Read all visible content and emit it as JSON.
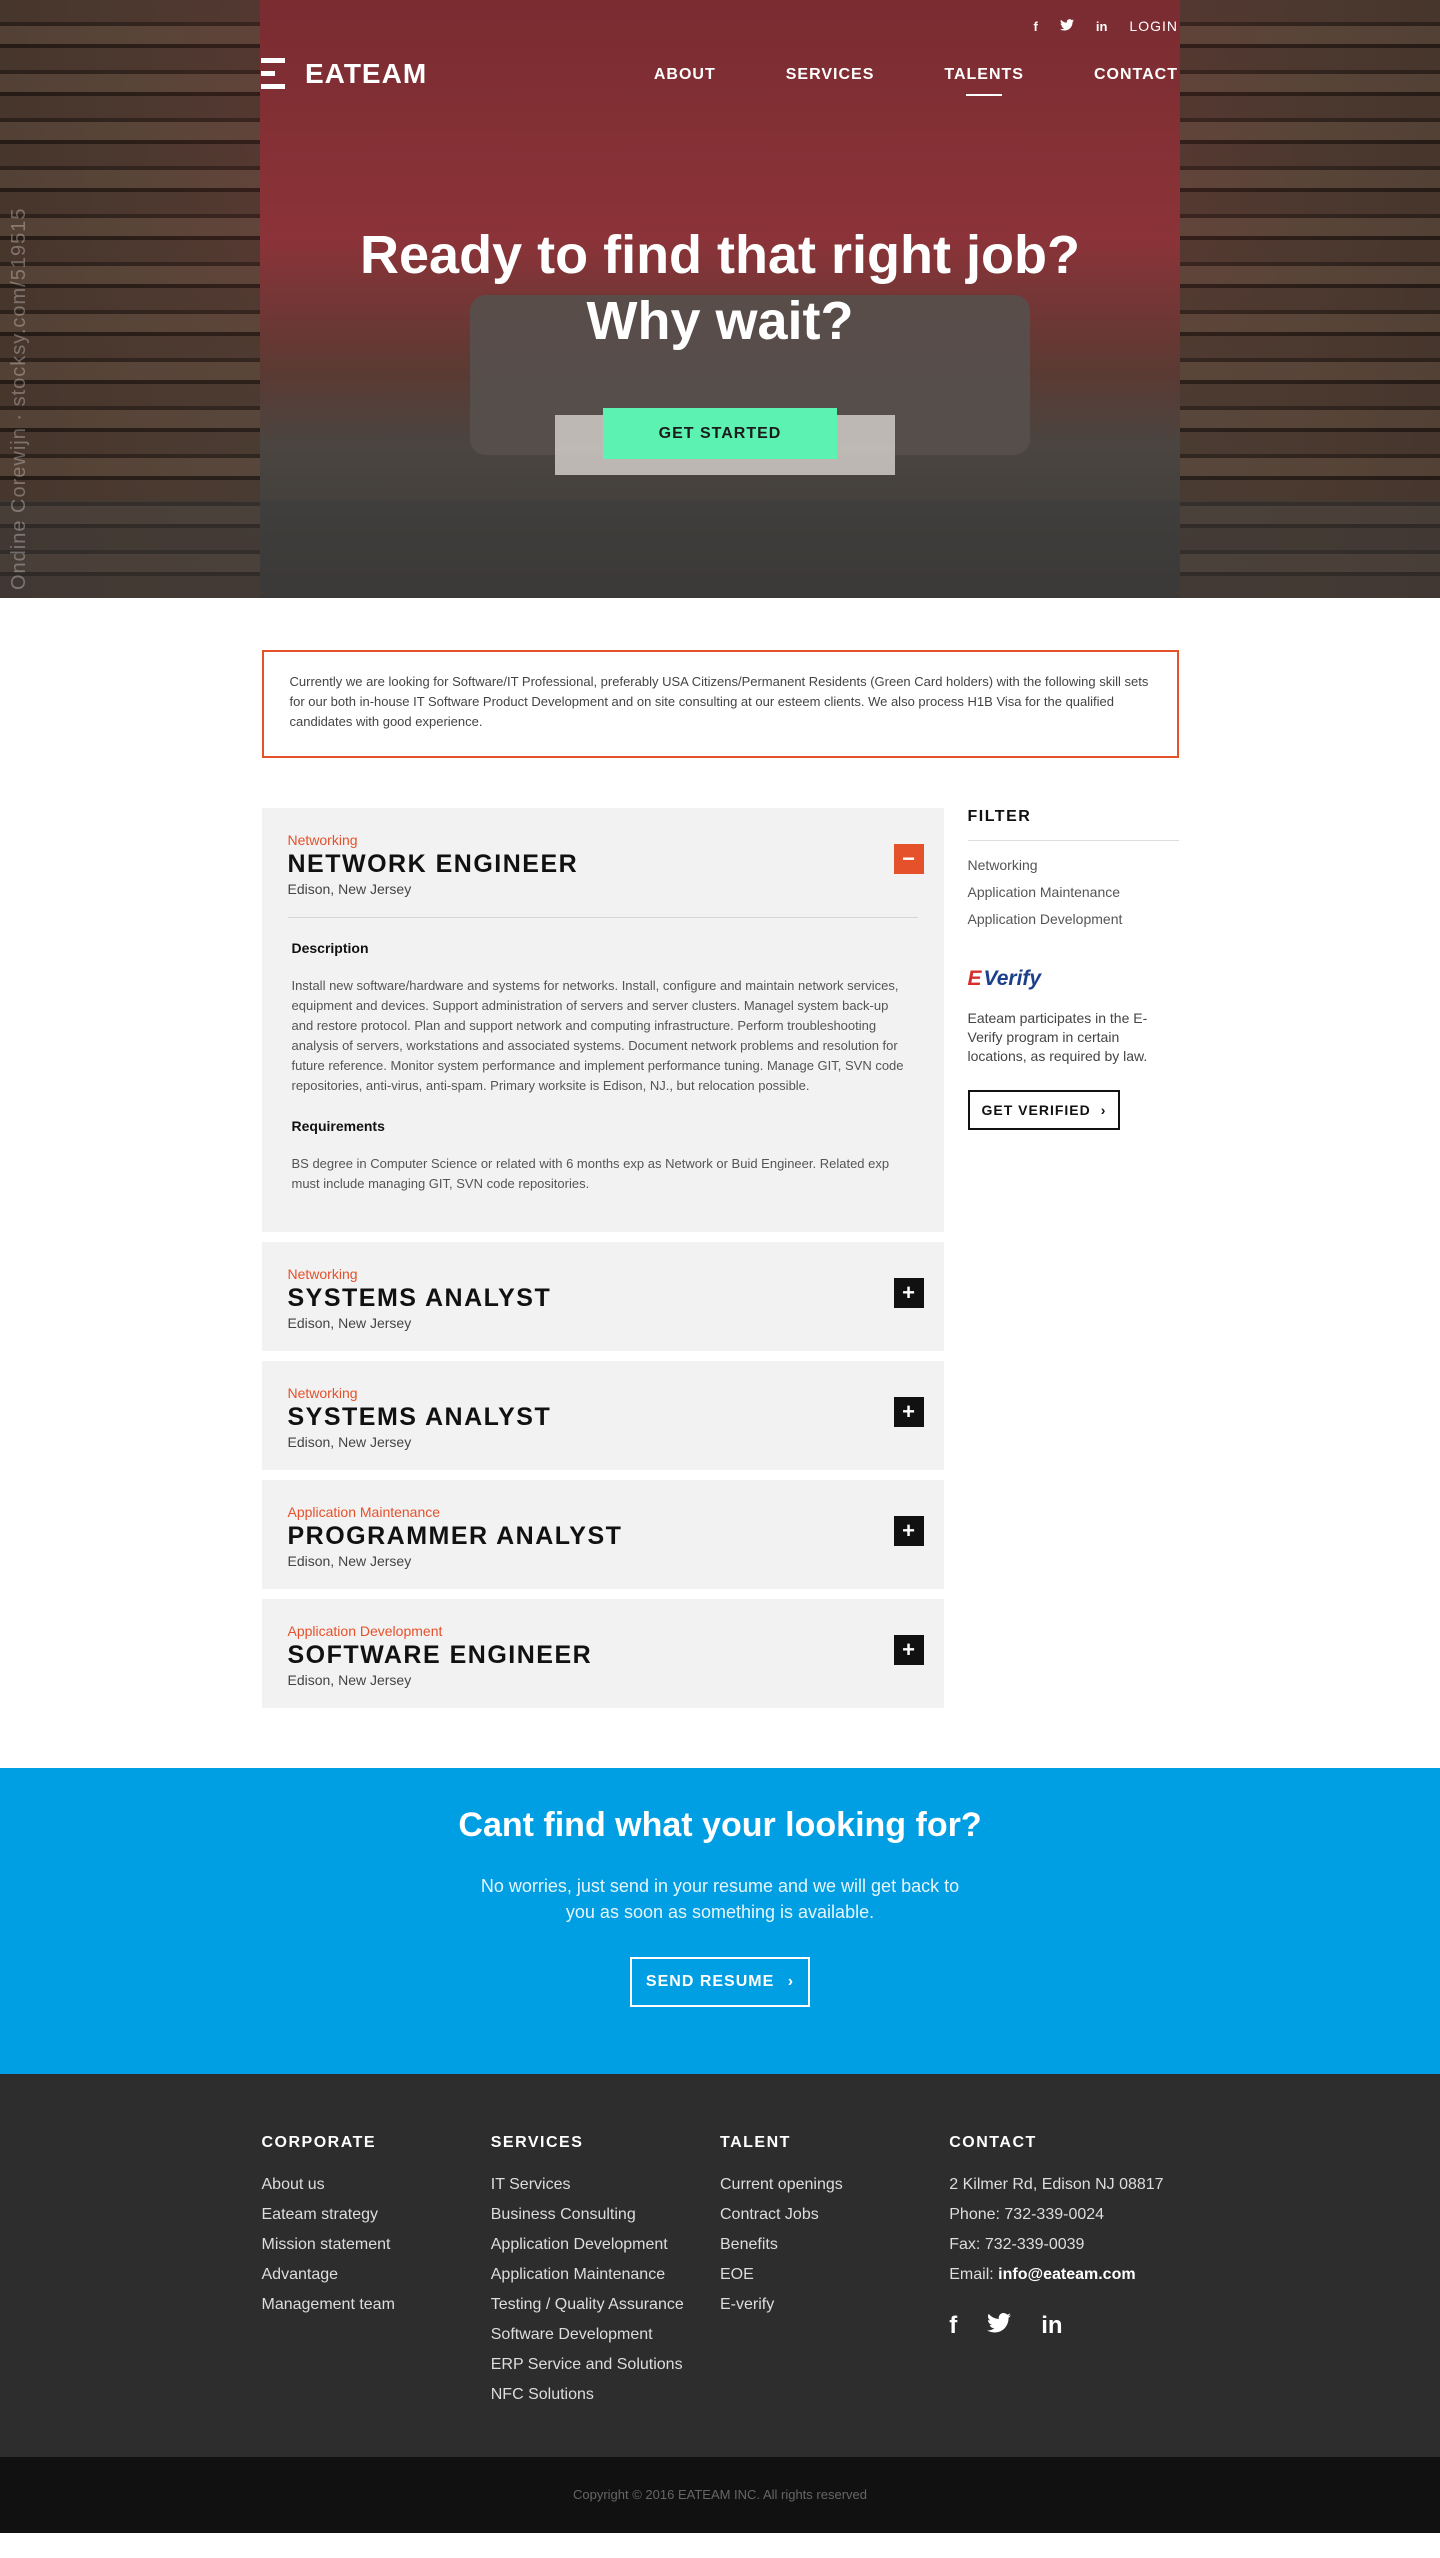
{
  "header": {
    "social": [
      "f",
      "t",
      "in"
    ],
    "login": "LOGIN",
    "logo_mark": "E",
    "logo_word": "EATEAM",
    "nav": [
      "ABOUT",
      "SERVICES",
      "TALENTS",
      "CONTACT"
    ],
    "active_nav": "TALENTS"
  },
  "hero": {
    "headline_line1": "Ready to find that right job?",
    "headline_line2": "Why wait?",
    "cta": "GET STARTED",
    "watermark": "Ondine Corewijn · stocksy.com/519515"
  },
  "notice": "Currently we are looking for Software/IT Professional, preferably USA Citizens/Permanent Residents (Green Card holders) with the following skill sets for our both in-house IT Software Product Development and on site consulting at our esteem clients. We also process H1B Visa for the qualified candidates with good experience.",
  "jobs": [
    {
      "category": "Networking",
      "title": "NETWORK ENGINEER",
      "location": "Edison, New Jersey",
      "toggle": "−",
      "description_label": "Description",
      "description": "Install new software/hardware and systems for networks. Install, configure and maintain network services, equipment and devices. Support administration of servers and server clusters. Managel system back-up and restore protocol. Plan and support network and computing infrastructure. Perform troubleshooting analysis of servers, workstations and associated systems. Document network problems and resolution for future reference. Monitor system performance and implement performance tuning. Manage GIT, SVN code repositories, anti-virus, anti-spam. Primary worksite is Edison, NJ., but relocation possible.",
      "requirements_label": "Requirements",
      "requirements": "BS degree in Computer Science or related with 6 months exp as Network or Buid Engineer. Related exp must include managing GIT, SVN code repositories."
    },
    {
      "category": "Networking",
      "title": "SYSTEMS ANALYST",
      "location": "Edison, New Jersey",
      "toggle": "+"
    },
    {
      "category": "Networking",
      "title": "SYSTEMS ANALYST",
      "location": "Edison, New Jersey",
      "toggle": "+"
    },
    {
      "category": "Application Maintenance",
      "title": "PROGRAMMER ANALYST",
      "location": "Edison, New Jersey",
      "toggle": "+"
    },
    {
      "category": "Application Development",
      "title": "SOFTWARE ENGINEER",
      "location": "Edison, New Jersey",
      "toggle": "+"
    }
  ],
  "sidebar": {
    "filter_title": "FILTER",
    "filters": [
      "Networking",
      "Application Maintenance",
      "Application Development"
    ],
    "everify_e": "E",
    "everify_word": "Verify",
    "everify_text": "Eateam participates in the E-Verify program in certain locations, as required by law.",
    "get_verified": "GET VERIFIED",
    "chevron": "›"
  },
  "band": {
    "title": "Cant find what your looking for?",
    "text": "No worries, just send in your resume and we will get back to you as soon as something is available.",
    "button": "SEND RESUME",
    "chevron": "›"
  },
  "footer": {
    "corporate": {
      "title": "CORPORATE",
      "items": [
        "About us",
        "Eateam strategy",
        "Mission statement",
        "Advantage",
        "Management team"
      ]
    },
    "services": {
      "title": "SERVICES",
      "items": [
        "IT Services",
        "Business Consulting",
        "Application Development",
        "Application Maintenance",
        "Testing / Quality Assurance",
        "Software Development",
        "ERP Service and Solutions",
        "NFC Solutions"
      ]
    },
    "talent": {
      "title": "TALENT",
      "items": [
        "Current openings",
        "Contract Jobs",
        "Benefits",
        "EOE",
        "E-verify"
      ]
    },
    "contact": {
      "title": "CONTACT",
      "address": "2 Kilmer Rd, Edison NJ 08817",
      "phone": "Phone: 732-339-0024",
      "fax": "Fax: 732-339-0039",
      "email_label": "Email:",
      "email": "info@eateam.com"
    },
    "social": [
      "f",
      "t",
      "in"
    ],
    "copyright": "Copyright © 2016 EATEAM INC. All rights reserved"
  },
  "colors": {
    "accent": "#e5512b",
    "cta": "#5cf2b1",
    "band": "#009ee2",
    "footer": "#2d2d2d"
  }
}
